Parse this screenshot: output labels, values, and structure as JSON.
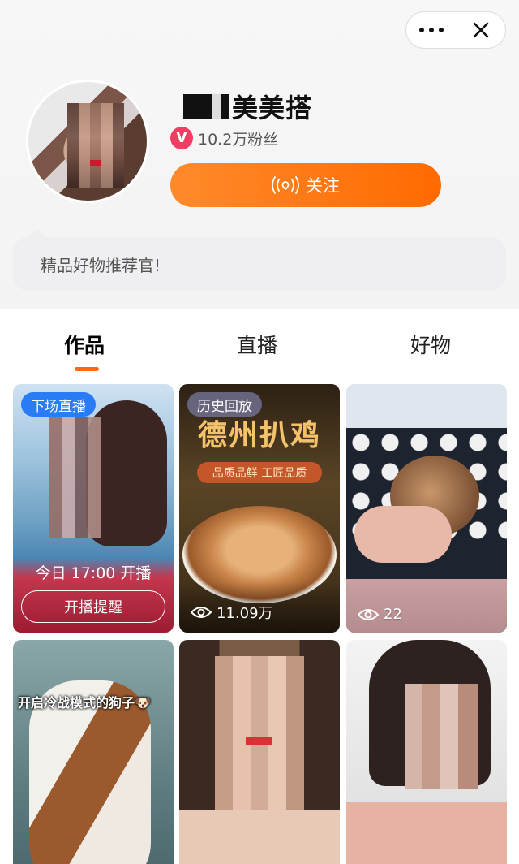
{
  "window": {
    "more_label": "•••",
    "close_label": "✕"
  },
  "profile": {
    "name": "美美搭",
    "fans": "10.2万粉丝",
    "verified_badge": "V",
    "follow_label": "关注",
    "bio": "精品好物推荐官!"
  },
  "tabs": [
    {
      "label": "作品",
      "active": true
    },
    {
      "label": "直播",
      "active": false
    },
    {
      "label": "好物",
      "active": false
    }
  ],
  "cards": [
    {
      "tag": "下场直播",
      "time": "今日 17:00 开播",
      "button": "开播提醒"
    },
    {
      "tag": "历史回放",
      "headline": "德州扒鸡",
      "subtitle": "品质品鲜 工匠品质",
      "views": "11.09万"
    },
    {
      "views": "22"
    },
    {
      "overlay_text": "开启冷战模式的狗子🐶"
    },
    {},
    {}
  ],
  "colors": {
    "accent": "#ff6a00",
    "live_tag": "#2a7cf6",
    "verified": "#f23d63"
  },
  "icons": [
    "more-icon",
    "close-icon",
    "verified-icon",
    "live-wave-icon",
    "eye-icon"
  ]
}
